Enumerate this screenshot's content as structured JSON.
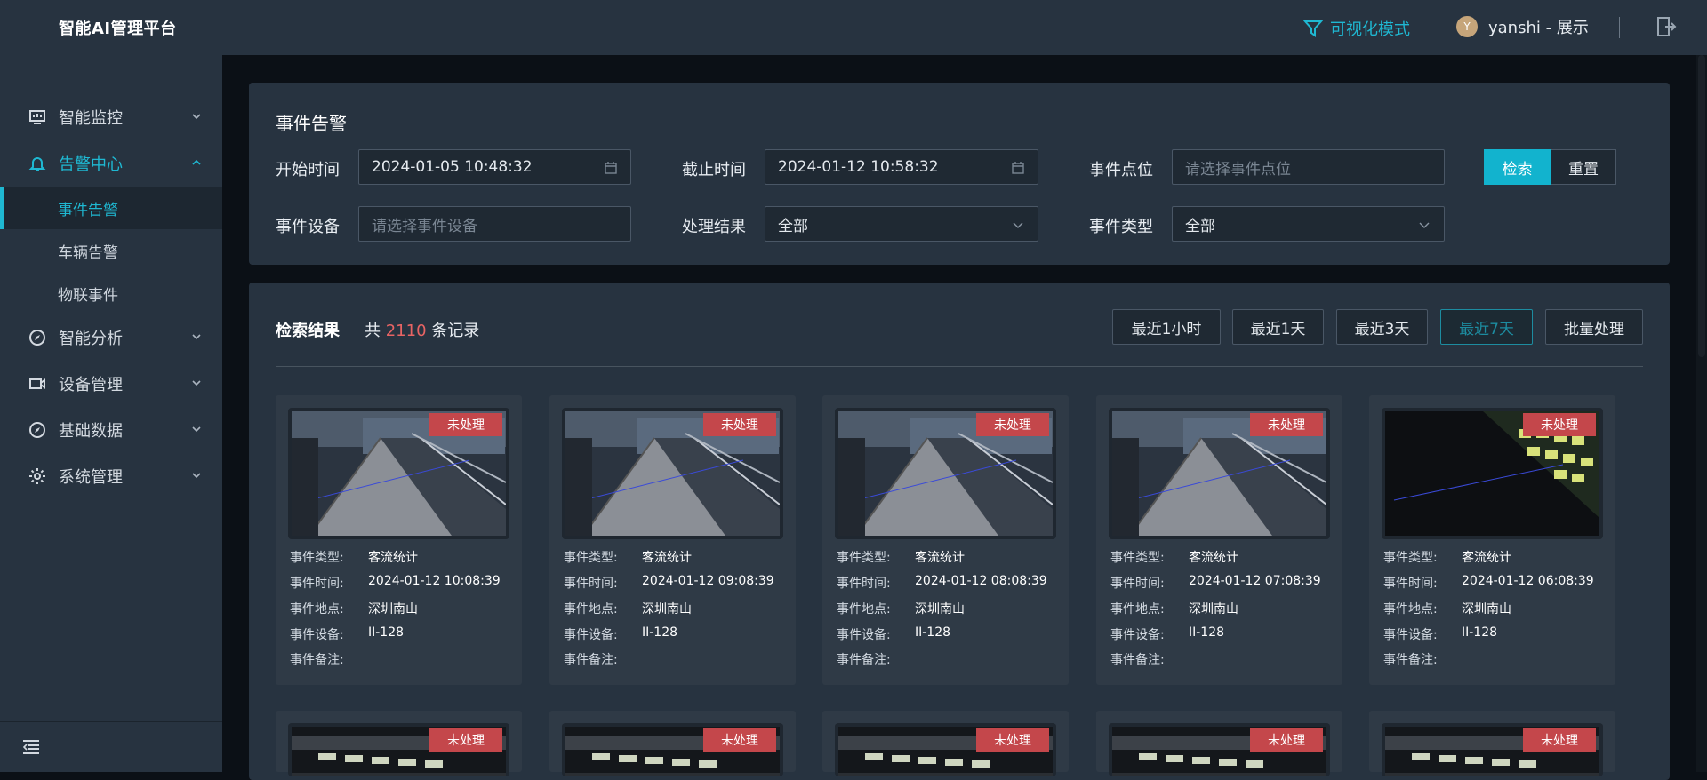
{
  "app": {
    "title": "智能AI管理平台"
  },
  "header": {
    "vis_mode": "可视化模式",
    "avatar_letter": "Y",
    "user": "yanshi - 展示"
  },
  "sidebar": {
    "items": [
      {
        "label": "智能监控",
        "icon": "monitor-icon"
      },
      {
        "label": "告警中心",
        "icon": "bell-icon",
        "expanded": true,
        "children": [
          {
            "label": "事件告警",
            "active": true
          },
          {
            "label": "车辆告警"
          },
          {
            "label": "物联事件"
          }
        ]
      },
      {
        "label": "智能分析",
        "icon": "compass-icon"
      },
      {
        "label": "设备管理",
        "icon": "camera-icon"
      },
      {
        "label": "基础数据",
        "icon": "compass-icon"
      },
      {
        "label": "系统管理",
        "icon": "gear-icon"
      }
    ]
  },
  "filter": {
    "title": "事件告警",
    "start_label": "开始时间",
    "start_value": "2024-01-05 10:48:32",
    "end_label": "截止时间",
    "end_value": "2024-01-12 10:58:32",
    "point_label": "事件点位",
    "point_placeholder": "请选择事件点位",
    "device_label": "事件设备",
    "device_placeholder": "请选择事件设备",
    "result_label": "处理结果",
    "result_value": "全部",
    "type_label": "事件类型",
    "type_value": "全部",
    "search": "检索",
    "reset": "重置"
  },
  "results": {
    "title": "检索结果",
    "count_prefix": "共",
    "count": "2110",
    "count_suffix": "条记录",
    "ranges": [
      "最近1小时",
      "最近1天",
      "最近3天",
      "最近7天",
      "批量处理"
    ],
    "active_range": "最近7天",
    "labels": {
      "type": "事件类型:",
      "time": "事件时间:",
      "place": "事件地点:",
      "device": "事件设备:",
      "note": "事件备注:"
    },
    "cards": [
      {
        "status": "未处理",
        "type": "客流统计",
        "time": "2024-01-12 10:08:39",
        "place": "深圳南山",
        "device": "II-128",
        "note": "",
        "scene": "bridge"
      },
      {
        "status": "未处理",
        "type": "客流统计",
        "time": "2024-01-12 09:08:39",
        "place": "深圳南山",
        "device": "II-128",
        "note": "",
        "scene": "bridge"
      },
      {
        "status": "未处理",
        "type": "客流统计",
        "time": "2024-01-12 08:08:39",
        "place": "深圳南山",
        "device": "II-128",
        "note": "",
        "scene": "bridge"
      },
      {
        "status": "未处理",
        "type": "客流统计",
        "time": "2024-01-12 07:08:39",
        "place": "深圳南山",
        "device": "II-128",
        "note": "",
        "scene": "bridge"
      },
      {
        "status": "未处理",
        "type": "客流统计",
        "time": "2024-01-12 06:08:39",
        "place": "深圳南山",
        "device": "II-128",
        "note": "",
        "scene": "night"
      }
    ],
    "row2_badges": [
      "未处理",
      "未处理",
      "未处理",
      "未处理",
      "未处理"
    ]
  },
  "colors": {
    "accent": "#1fb8d2",
    "badge": "#c4474b",
    "count": "#e86464"
  }
}
